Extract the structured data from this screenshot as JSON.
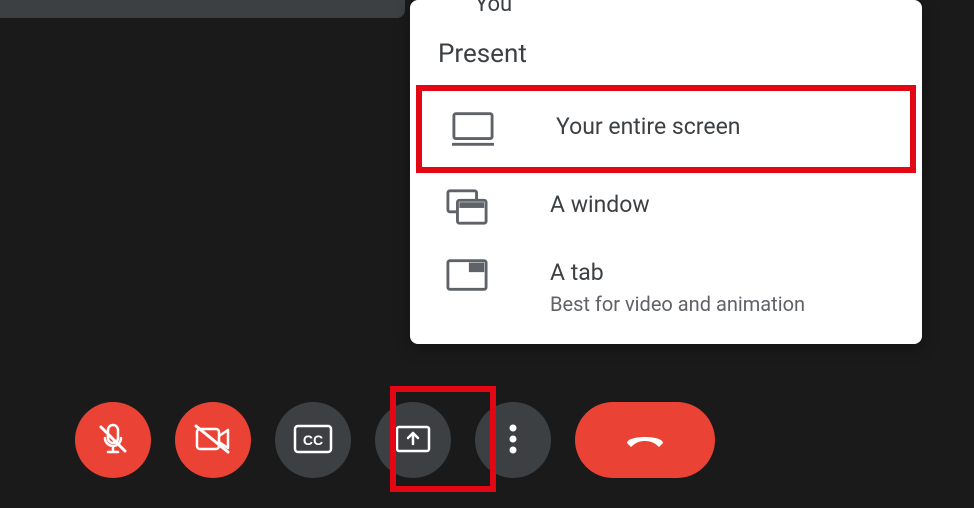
{
  "participant_label": "You",
  "popup": {
    "header": "Present",
    "options": [
      {
        "label": "Your entire screen",
        "sublabel": ""
      },
      {
        "label": "A window",
        "sublabel": ""
      },
      {
        "label": "A tab",
        "sublabel": "Best for video and animation"
      }
    ]
  },
  "toolbar": {
    "mute": "Mute microphone",
    "camera": "Turn off camera",
    "cc": "Captions",
    "present": "Present now",
    "more": "More options",
    "end": "Leave call"
  }
}
